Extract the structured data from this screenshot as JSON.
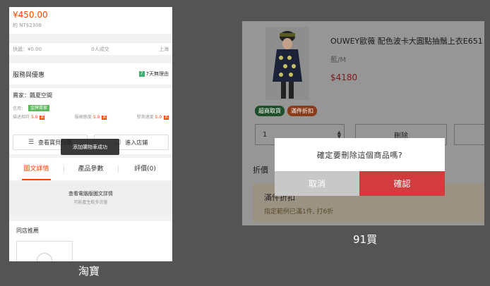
{
  "taobao": {
    "price": "¥450.00",
    "price_approx": "約 NT$2308",
    "shipping": "快遞：¥0.00",
    "sold": "0人成交",
    "location": "上海",
    "service_title": "服務與優惠",
    "return_badge": "7",
    "return_text": "7天無理由",
    "store_name": "賣家：飄夏空間",
    "credit_label": "信用：",
    "certified_badge": "金牌賣家",
    "ratings": [
      {
        "label": "描述相符",
        "value": "5.0",
        "badge": "高"
      },
      {
        "label": "服務態度",
        "value": "5.0",
        "badge": "高"
      },
      {
        "label": "發貨速度",
        "value": "5.0",
        "badge": "高"
      }
    ],
    "view_all_button": "查看寶貝分類",
    "enter_store_button": "進入店鋪",
    "tabs": [
      "圖文詳情",
      "產品參數",
      "評價(0)"
    ],
    "desc_main": "查看電腦版圖文詳情",
    "desc_sub": "可能產生較多流量",
    "recommend_title": "同店推薦",
    "toast": "添加購物車成功",
    "caption": "淘寶"
  },
  "ninety_one": {
    "product_title": "OUWEY歐薇 配色波卡大圓點抽鬚上衣E651",
    "product_spec": "藍/M",
    "product_price": "$4180",
    "tags": [
      "超商取貨",
      "滿件折扣"
    ],
    "quantity": "1",
    "delete_button": "刪除",
    "discount_heading": "折價",
    "promo_title": "滿件折扣",
    "promo_sub": "指定範例已滿1件, 打6折",
    "dialog_message": "確定要刪除這個商品嗎?",
    "dialog_cancel": "取消",
    "dialog_confirm": "確認",
    "caption": "91買"
  },
  "colors": {
    "taobao_accent": "#ff4400",
    "confirm_red": "#d33c3f",
    "background": "#545454"
  }
}
